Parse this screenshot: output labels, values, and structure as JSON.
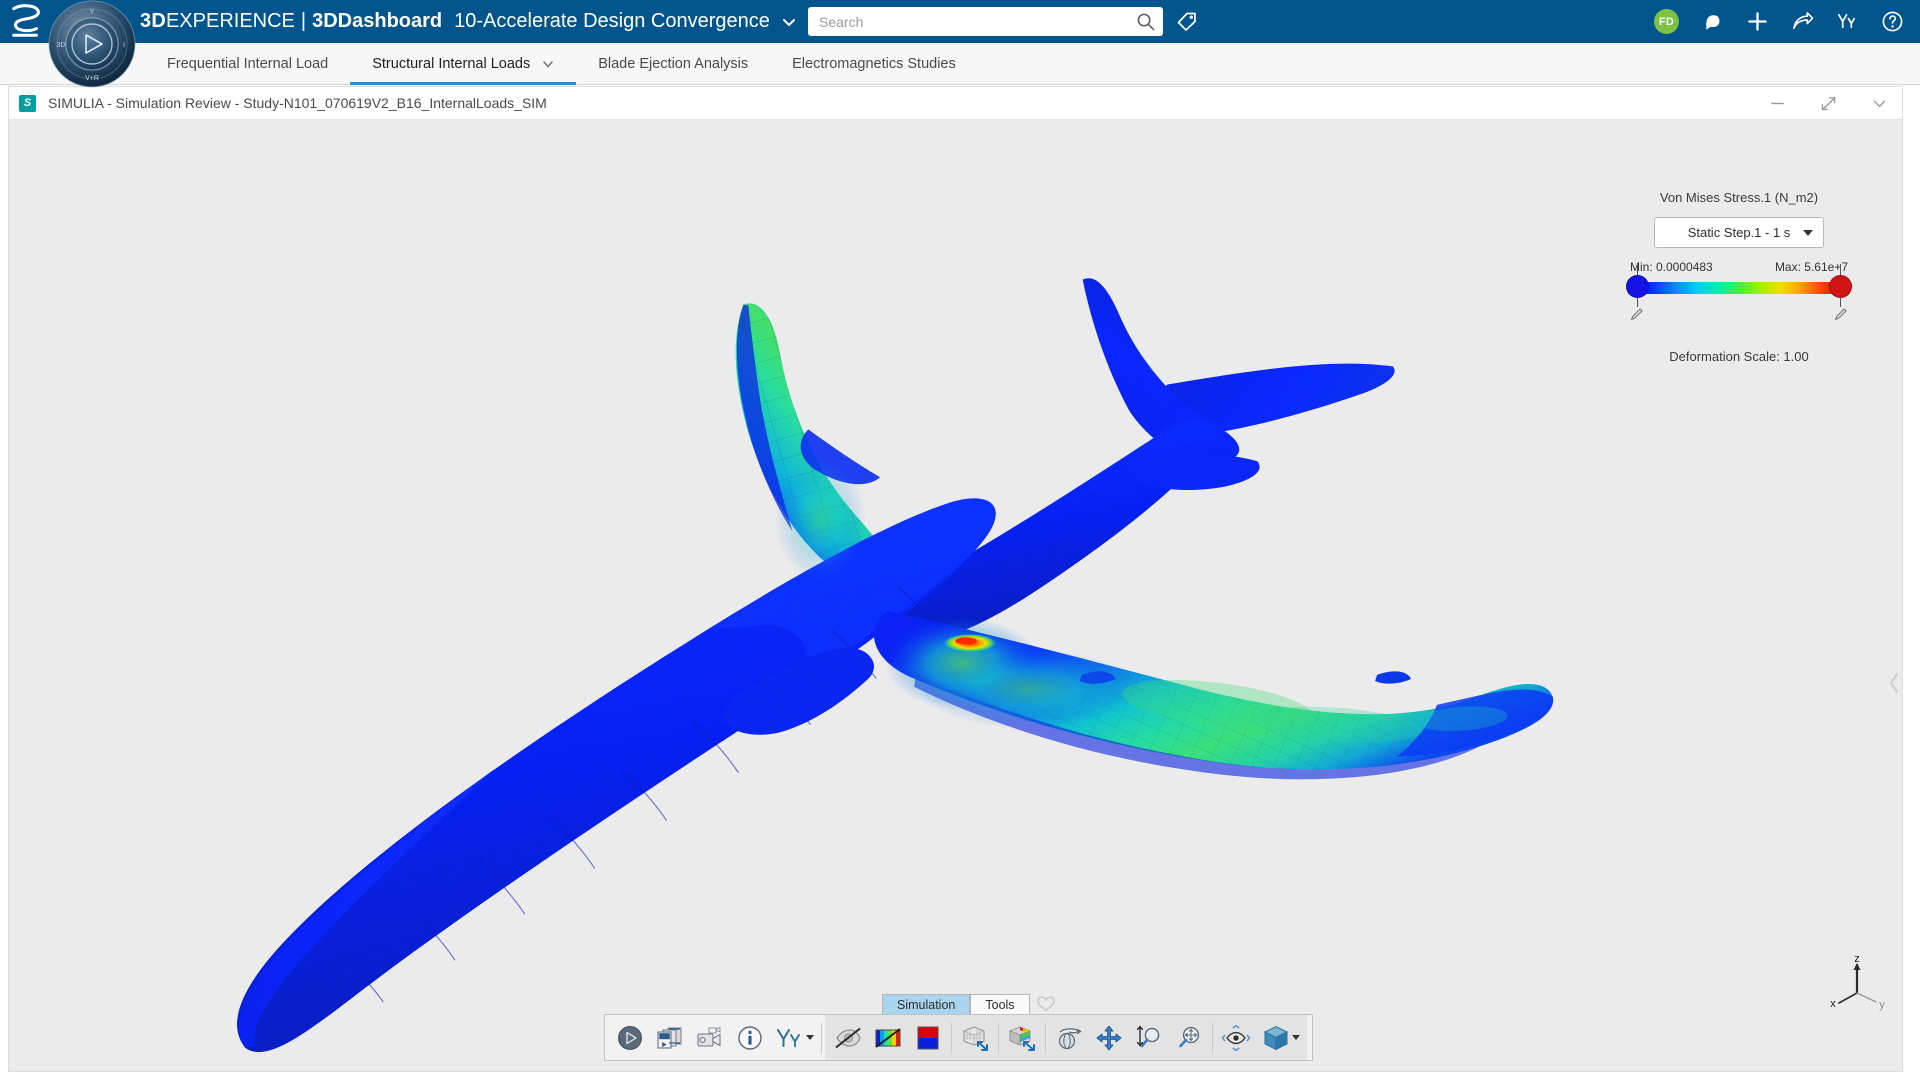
{
  "header": {
    "brand_3d": "3D",
    "brand_experience": "EXPERIENCE",
    "brand_separator": "|",
    "brand_dashboard": "3DDashboard",
    "dashboard_name": "10-Accelerate Design Convergence",
    "search_placeholder": "Search",
    "search_value": "",
    "avatar_initials": "FD",
    "icons": {
      "ds_logo": "3ds-logo",
      "compass": "3dexperience-compass",
      "brand_caret": "chevron-down-icon",
      "search": "search-icon",
      "tag": "tag-icon",
      "notification": "notification-bell-icon",
      "add": "plus-icon",
      "share": "share-arrow-icon",
      "community": "community-people-icon",
      "help": "help-question-icon"
    },
    "compass_labels": {
      "top": "Y",
      "left": "3D",
      "right": "i",
      "bottom": "V+R"
    }
  },
  "tabs": [
    {
      "label": "Frequential Internal Load",
      "active": false,
      "has_caret": false
    },
    {
      "label": "Structural Internal Loads",
      "active": true,
      "has_caret": true
    },
    {
      "label": "Blade Ejection Analysis",
      "active": false,
      "has_caret": false
    },
    {
      "label": "Electromagnetics Studies",
      "active": false,
      "has_caret": false
    }
  ],
  "app_window": {
    "title": "SIMULIA - Simulation Review - Study-N101_070619V2_B16_InternalLoads_SIM",
    "app_icon": "simulia-icon",
    "controls": {
      "minimize": "minimize-icon",
      "expand": "expand-diagonal-icon",
      "collapse": "chevron-down-icon"
    }
  },
  "legend": {
    "title": "Von Mises Stress.1 (N_m2)",
    "step_value": "Static Step.1 - 1 s",
    "min_label": "Min: 0.0000483",
    "max_label": "Max: 5.61e+7",
    "deformation_scale": "Deformation Scale: 1.00",
    "min_handle_color": "#1414e6",
    "max_handle_color": "#d11414",
    "edit_min_icon": "pencil-icon",
    "edit_max_icon": "pencil-icon"
  },
  "viewport": {
    "background_color": "#ebebeb",
    "model": "aircraft-von-mises-stress-plot",
    "axis_triad": {
      "x": "x",
      "y": "y",
      "z": "z"
    },
    "collapse_handle_icon": "chevron-left-icon"
  },
  "toolbar_tabs": [
    {
      "label": "Simulation",
      "active": true
    },
    {
      "label": "Tools",
      "active": false
    }
  ],
  "toolbar_tabs_extra_icon": "favorites-heart-icon",
  "toolbar": {
    "group1": [
      {
        "name": "play-simulation-button",
        "icon": "play-circle-icon"
      },
      {
        "name": "play-all-frames-button",
        "icon": "filmstrip-play-icon"
      },
      {
        "name": "record-video-button",
        "icon": "video-camera-icon"
      },
      {
        "name": "information-button",
        "icon": "info-circle-icon"
      },
      {
        "name": "community-button",
        "icon": "community-people-icon",
        "has_caret": true
      }
    ],
    "group2": [
      {
        "name": "hide-show-button",
        "icon": "eye-slash-icon"
      },
      {
        "name": "contour-off-button",
        "icon": "spectrum-slash-icon"
      },
      {
        "name": "color-map-button",
        "icon": "red-blue-swatch-icon"
      },
      {
        "name": "mesh-deform-button",
        "icon": "mesh-cube-arrows-icon"
      },
      {
        "name": "solid-deform-button",
        "icon": "color-cube-arrows-icon"
      },
      {
        "name": "rotate-button",
        "icon": "rotate-trackball-icon"
      },
      {
        "name": "pan-button",
        "icon": "pan-four-arrows-icon"
      },
      {
        "name": "zoom-button",
        "icon": "zoom-updown-magnifier-icon"
      },
      {
        "name": "fit-all-button",
        "icon": "fit-all-magnifier-icon"
      },
      {
        "name": "look-at-button",
        "icon": "look-at-eye-icon"
      },
      {
        "name": "view-cube-button",
        "icon": "view-cube-icon",
        "has_caret": true
      }
    ]
  },
  "chart_data": {
    "type": "heatmap",
    "title": "Von Mises Stress.1 (N_m2)",
    "subtitle": "Static Step.1 - 1 s",
    "colormap": "rainbow",
    "min": 4.83e-05,
    "max": 56100000,
    "min_text": "Min: 0.0000483",
    "max_text": "Max: 5.61e+7",
    "units": "N_m2",
    "deformation_scale": 1.0,
    "legend_position": "top-right",
    "colorbar_stops": [
      "#0000ff",
      "#0040ff",
      "#0090ff",
      "#00d0f0",
      "#00f0b0",
      "#40f040",
      "#a0f000",
      "#f0e000",
      "#ffa000",
      "#ff4000",
      "#e00000"
    ],
    "notes": "Aircraft FEA von Mises stress contour; fuselage and inner wing predominantly blue (low stress), wing root and vertical/horizontal stabilizer surfaces green-cyan (mid stress), small red hotspot at wing-fuselage junction (max)."
  }
}
